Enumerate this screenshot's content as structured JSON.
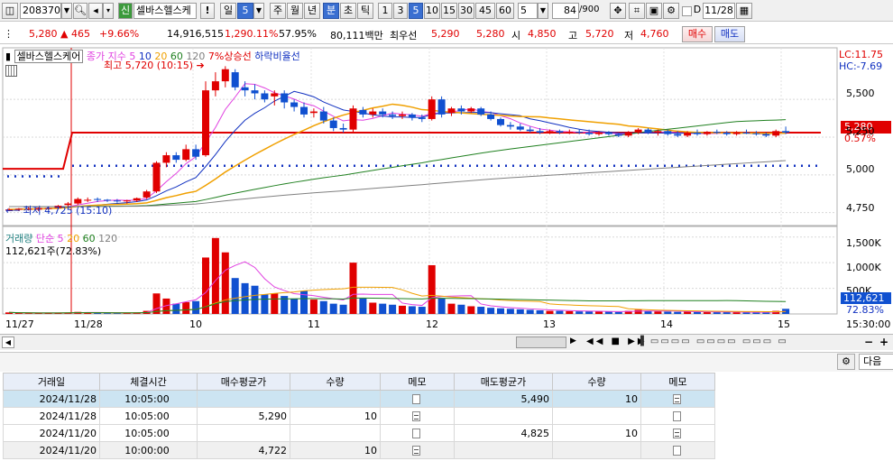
{
  "toolbar": {
    "stock_code": "208370",
    "stock_badge": "신",
    "stock_name": "셀바스헬스케",
    "alert": "!",
    "period_daily": "일",
    "period_count": "5",
    "periods": [
      "주",
      "월",
      "년",
      "분",
      "초",
      "틱"
    ],
    "minute_options": [
      "1",
      "3",
      "5",
      "10",
      "15",
      "30",
      "45",
      "60"
    ],
    "selected_minute": "5",
    "interval_value": "5",
    "bars_shown": "84",
    "bars_total": "/900",
    "date_checkbox_label": "D",
    "date_value": "11/28"
  },
  "quote": {
    "price": "5,280",
    "change": "465",
    "change_pct": "+9.66%",
    "volume": "14,916,515",
    "volume_ratio": "1,290.11%",
    "turnover_ratio": "57.95%",
    "amount": "80,111백만",
    "best_ask_label": "최우선",
    "best_ask": "5,290",
    "best_bid": "5,280",
    "open_label": "시",
    "open": "4,850",
    "high_label": "고",
    "high": "5,720",
    "low_label": "저",
    "low": "4,760",
    "buy_button": "매수",
    "sell_button": "매도"
  },
  "price_panel": {
    "stock_label": "셀바스헬스케어",
    "legend_close": "종가 지수",
    "ma_legend": [
      "5",
      "10",
      "20",
      "60",
      "120"
    ],
    "up_line_label": "7%상승선",
    "down_line_label": "하락비율선",
    "lc_label": "LC:11.75",
    "hc_label": "HC:-7.69",
    "high_annotation": "최고 5,720 (10:15)",
    "low_annotation": "최저 4,725 (15:10)",
    "current_price_tag": "5,280",
    "current_pct_tag": "0.57%",
    "y_ticks": [
      "5,500",
      "5,250",
      "5,000",
      "4,750"
    ]
  },
  "volume_panel": {
    "title": "거래량",
    "legend_simple": "단순",
    "ma_legend": [
      "5",
      "20",
      "60",
      "120"
    ],
    "current_volume": "112,621주(72.83%)",
    "y_ticks": [
      "1,500K",
      "1,000K",
      "500K"
    ],
    "current_tag": "112,621",
    "current_pct": "72.83%"
  },
  "x_axis": {
    "labels": [
      "11/27",
      "11/28",
      "10",
      "11",
      "12",
      "13",
      "14",
      "15",
      "15:30:00"
    ]
  },
  "chart_data": {
    "type": "candlestick",
    "interval": "5 min",
    "ylim": [
      4700,
      5800
    ],
    "candles": [
      [
        4770,
        4780,
        4760,
        4770
      ],
      [
        4770,
        4780,
        4760,
        4775
      ],
      [
        4775,
        4790,
        4765,
        4775
      ],
      [
        4770,
        4785,
        4760,
        4780
      ],
      [
        4780,
        4790,
        4770,
        4780
      ],
      [
        4780,
        4800,
        4775,
        4795
      ],
      [
        4800,
        4820,
        4790,
        4810
      ],
      [
        4810,
        4850,
        4800,
        4840
      ],
      [
        4830,
        4850,
        4820,
        4835
      ],
      [
        4840,
        4850,
        4820,
        4835
      ],
      [
        4835,
        4840,
        4820,
        4830
      ],
      [
        4830,
        4840,
        4815,
        4825
      ],
      [
        4825,
        4835,
        4810,
        4830
      ],
      [
        4830,
        4850,
        4820,
        4845
      ],
      [
        4850,
        4900,
        4840,
        4890
      ],
      [
        4890,
        5090,
        4880,
        5080
      ],
      [
        5080,
        5150,
        5050,
        5130
      ],
      [
        5130,
        5150,
        5080,
        5100
      ],
      [
        5100,
        5200,
        5090,
        5170
      ],
      [
        5170,
        5200,
        5100,
        5120
      ],
      [
        5130,
        5620,
        5120,
        5560
      ],
      [
        5560,
        5680,
        5520,
        5620
      ],
      [
        5620,
        5720,
        5580,
        5700
      ],
      [
        5680,
        5700,
        5560,
        5580
      ],
      [
        5580,
        5620,
        5520,
        5560
      ],
      [
        5560,
        5600,
        5500,
        5540
      ],
      [
        5540,
        5560,
        5480,
        5500
      ],
      [
        5520,
        5560,
        5460,
        5540
      ],
      [
        5540,
        5560,
        5440,
        5480
      ],
      [
        5480,
        5500,
        5420,
        5450
      ],
      [
        5450,
        5480,
        5380,
        5400
      ],
      [
        5410,
        5440,
        5380,
        5420
      ],
      [
        5420,
        5450,
        5340,
        5360
      ],
      [
        5360,
        5380,
        5290,
        5310
      ],
      [
        5310,
        5340,
        5280,
        5300
      ],
      [
        5300,
        5460,
        5280,
        5440
      ],
      [
        5430,
        5450,
        5380,
        5400
      ],
      [
        5400,
        5440,
        5380,
        5420
      ],
      [
        5420,
        5440,
        5380,
        5400
      ],
      [
        5400,
        5420,
        5370,
        5390
      ],
      [
        5390,
        5420,
        5370,
        5400
      ],
      [
        5400,
        5410,
        5360,
        5380
      ],
      [
        5380,
        5400,
        5350,
        5370
      ],
      [
        5370,
        5520,
        5360,
        5500
      ],
      [
        5500,
        5520,
        5380,
        5400
      ],
      [
        5410,
        5450,
        5390,
        5440
      ],
      [
        5440,
        5460,
        5400,
        5420
      ],
      [
        5420,
        5450,
        5410,
        5440
      ],
      [
        5440,
        5450,
        5390,
        5400
      ],
      [
        5400,
        5420,
        5360,
        5370
      ],
      [
        5370,
        5380,
        5320,
        5330
      ],
      [
        5330,
        5350,
        5300,
        5320
      ],
      [
        5320,
        5340,
        5290,
        5300
      ],
      [
        5300,
        5320,
        5280,
        5290
      ],
      [
        5290,
        5310,
        5270,
        5280
      ],
      [
        5280,
        5300,
        5270,
        5290
      ],
      [
        5290,
        5300,
        5270,
        5280
      ],
      [
        5280,
        5300,
        5270,
        5285
      ],
      [
        5285,
        5300,
        5270,
        5280
      ],
      [
        5280,
        5300,
        5260,
        5270
      ],
      [
        5270,
        5290,
        5260,
        5280
      ],
      [
        5280,
        5290,
        5260,
        5270
      ],
      [
        5270,
        5280,
        5250,
        5260
      ],
      [
        5260,
        5290,
        5250,
        5280
      ],
      [
        5280,
        5310,
        5270,
        5300
      ],
      [
        5300,
        5310,
        5270,
        5280
      ],
      [
        5280,
        5300,
        5260,
        5290
      ],
      [
        5290,
        5300,
        5260,
        5270
      ],
      [
        5270,
        5290,
        5250,
        5260
      ],
      [
        5260,
        5290,
        5250,
        5280
      ],
      [
        5280,
        5300,
        5260,
        5270
      ],
      [
        5270,
        5290,
        5260,
        5285
      ],
      [
        5285,
        5300,
        5270,
        5280
      ],
      [
        5280,
        5290,
        5260,
        5270
      ],
      [
        5270,
        5290,
        5260,
        5280
      ],
      [
        5280,
        5300,
        5270,
        5275
      ],
      [
        5275,
        5290,
        5260,
        5270
      ],
      [
        5270,
        5280,
        5250,
        5260
      ],
      [
        5260,
        5300,
        5250,
        5290
      ],
      [
        5290,
        5320,
        5270,
        5280
      ]
    ],
    "volumes_k": [
      30,
      20,
      15,
      15,
      20,
      25,
      25,
      40,
      30,
      20,
      15,
      15,
      20,
      30,
      60,
      400,
      300,
      200,
      230,
      250,
      1100,
      1480,
      1200,
      700,
      600,
      550,
      380,
      400,
      350,
      300,
      450,
      280,
      250,
      200,
      180,
      1000,
      300,
      220,
      200,
      180,
      160,
      150,
      140,
      950,
      300,
      200,
      180,
      150,
      140,
      120,
      110,
      100,
      90,
      80,
      70,
      60,
      60,
      55,
      50,
      50,
      45,
      45,
      40,
      60,
      80,
      60,
      50,
      45,
      40,
      45,
      40,
      35,
      35,
      40,
      35,
      30,
      30,
      30,
      60,
      100
    ],
    "reference_lines": {
      "up_7pct": 5280,
      "low_reference": 5040
    }
  },
  "orders_table": {
    "headers": [
      "거래일",
      "체결시간",
      "매수평균가",
      "수량",
      "메모",
      "매도평균가",
      "수량",
      "메모"
    ],
    "rows": [
      [
        "2024/11/28",
        "10:05:00",
        "",
        "",
        "empty",
        "5,490",
        "10",
        "filled"
      ],
      [
        "2024/11/28",
        "10:05:00",
        "5,290",
        "10",
        "filled",
        "",
        "",
        "empty"
      ],
      [
        "2024/11/20",
        "10:05:00",
        "",
        "",
        "empty",
        "4,825",
        "10",
        "filled"
      ],
      [
        "2024/11/20",
        "10:00:00",
        "4,722",
        "10",
        "filled",
        "",
        "",
        "empty"
      ]
    ],
    "next_button": "다음"
  },
  "colors": {
    "up": "#e00000",
    "down": "#1050d0",
    "ma5": "#e040e0",
    "ma10": "#1030c0",
    "ma20": "#f0a000",
    "ma60": "#208020",
    "ma120": "#808080"
  }
}
